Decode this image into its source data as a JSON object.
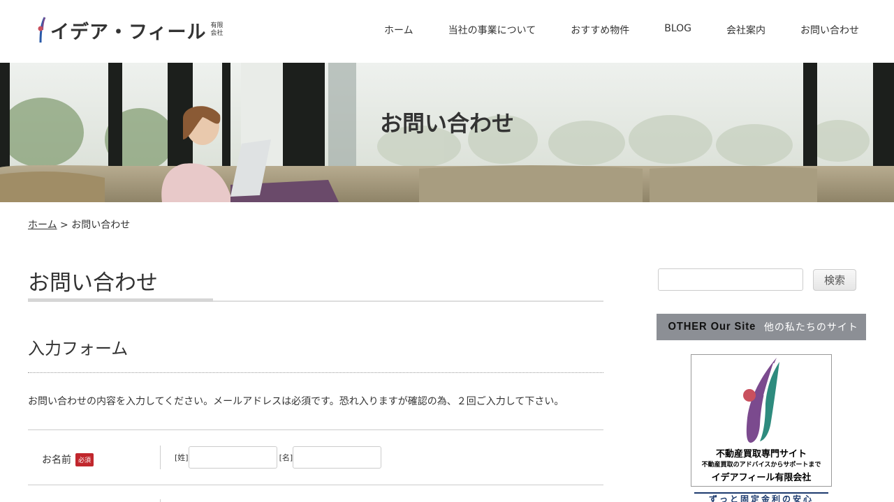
{
  "header": {
    "logo_text": "イデア・フィール",
    "logo_sub_1": "有限",
    "logo_sub_2": "会社",
    "nav": [
      "ホーム",
      "当社の事業について",
      "おすすめ物件",
      "BLOG",
      "会社案内",
      "お問い合わせ"
    ]
  },
  "hero": {
    "title": "お問い合わせ"
  },
  "breadcrumb": {
    "home": "ホーム",
    "separator": " > ",
    "current": "お問い合わせ"
  },
  "main": {
    "page_title": "お問い合わせ",
    "section_title": "入力フォーム",
    "intro": "お問い合わせの内容を入力してください。メールアドレスは必須です。恐れ入りますが確認の為、２回ご入力して下さい。",
    "name_label": "お名前",
    "required_badge": "必須",
    "last_name_label": "[姓]",
    "first_name_label": "[名]"
  },
  "sidebar": {
    "search_button": "検索",
    "other_title_en": "OTHER Our Site",
    "other_title_jp": "他の私たちのサイト",
    "banner_line1": "不動産買取専門サイト",
    "banner_line2": "不動産買取のアドバイスからサポートまで",
    "banner_line3": "イデアフィール有限会社",
    "banner2_text": "ずっと固定金利の安心"
  },
  "colors": {
    "required_badge": "#c1272d",
    "sidebar_header": "#8c8f95",
    "banner_purple": "#7b4a8e",
    "banner_teal": "#2e8b7e",
    "banner_red": "#c9505e"
  }
}
